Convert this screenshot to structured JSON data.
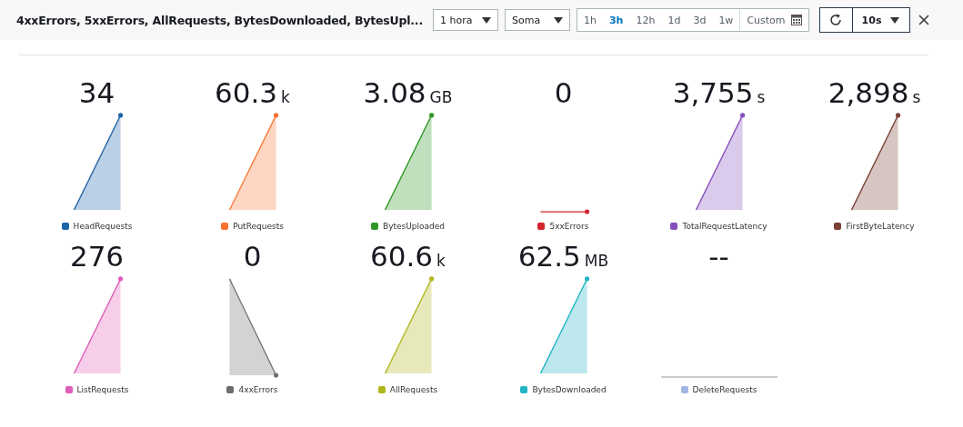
{
  "toolbar": {
    "title": "4xxErrors, 5xxErrors, AllRequests, BytesDownloaded, BytesUpl...",
    "period": "1 hora",
    "statistic": "Soma",
    "ranges": [
      {
        "label": "1h",
        "selected": false
      },
      {
        "label": "3h",
        "selected": true
      },
      {
        "label": "12h",
        "selected": false
      },
      {
        "label": "1d",
        "selected": false
      },
      {
        "label": "3d",
        "selected": false
      },
      {
        "label": "1w",
        "selected": false
      }
    ],
    "custom": "Custom",
    "refresh_interval": "10s"
  },
  "metrics": [
    {
      "value": "34",
      "name": "HeadRequests",
      "color": "#1f64a8",
      "kind": "rising"
    },
    {
      "value": "60.3",
      "unit": "k",
      "name": "PutRequests",
      "color": "#f7732f",
      "kind": "rising"
    },
    {
      "value": "3.08",
      "unit": "GB",
      "name": "BytesUploaded",
      "color": "#2e9625",
      "kind": "rising"
    },
    {
      "value": "0",
      "name": "5xxErrors",
      "color": "#d6222b",
      "kind": "flat"
    },
    {
      "value": "3,755",
      "unit": "s",
      "name": "TotalRequestLatency",
      "color": "#8650bc",
      "kind": "rising"
    },
    {
      "value": "2,898",
      "unit": "s",
      "name": "FirstByteLatency",
      "color": "#7a3f35",
      "kind": "rising"
    },
    {
      "value": "276",
      "name": "ListRequests",
      "color": "#e05cb8",
      "kind": "rising"
    },
    {
      "value": "0",
      "name": "4xxErrors",
      "color": "#6d6d6d",
      "kind": "falling"
    },
    {
      "value": "60.6",
      "unit": "k",
      "name": "AllRequests",
      "color": "#b1b61d",
      "kind": "rising"
    },
    {
      "value": "62.5",
      "unit": "MB",
      "name": "BytesDownloaded",
      "color": "#22b3c5",
      "kind": "rising"
    },
    {
      "value": "--",
      "name": "DeleteRequests",
      "color": "#a3b7e4",
      "kind": "empty"
    }
  ]
}
